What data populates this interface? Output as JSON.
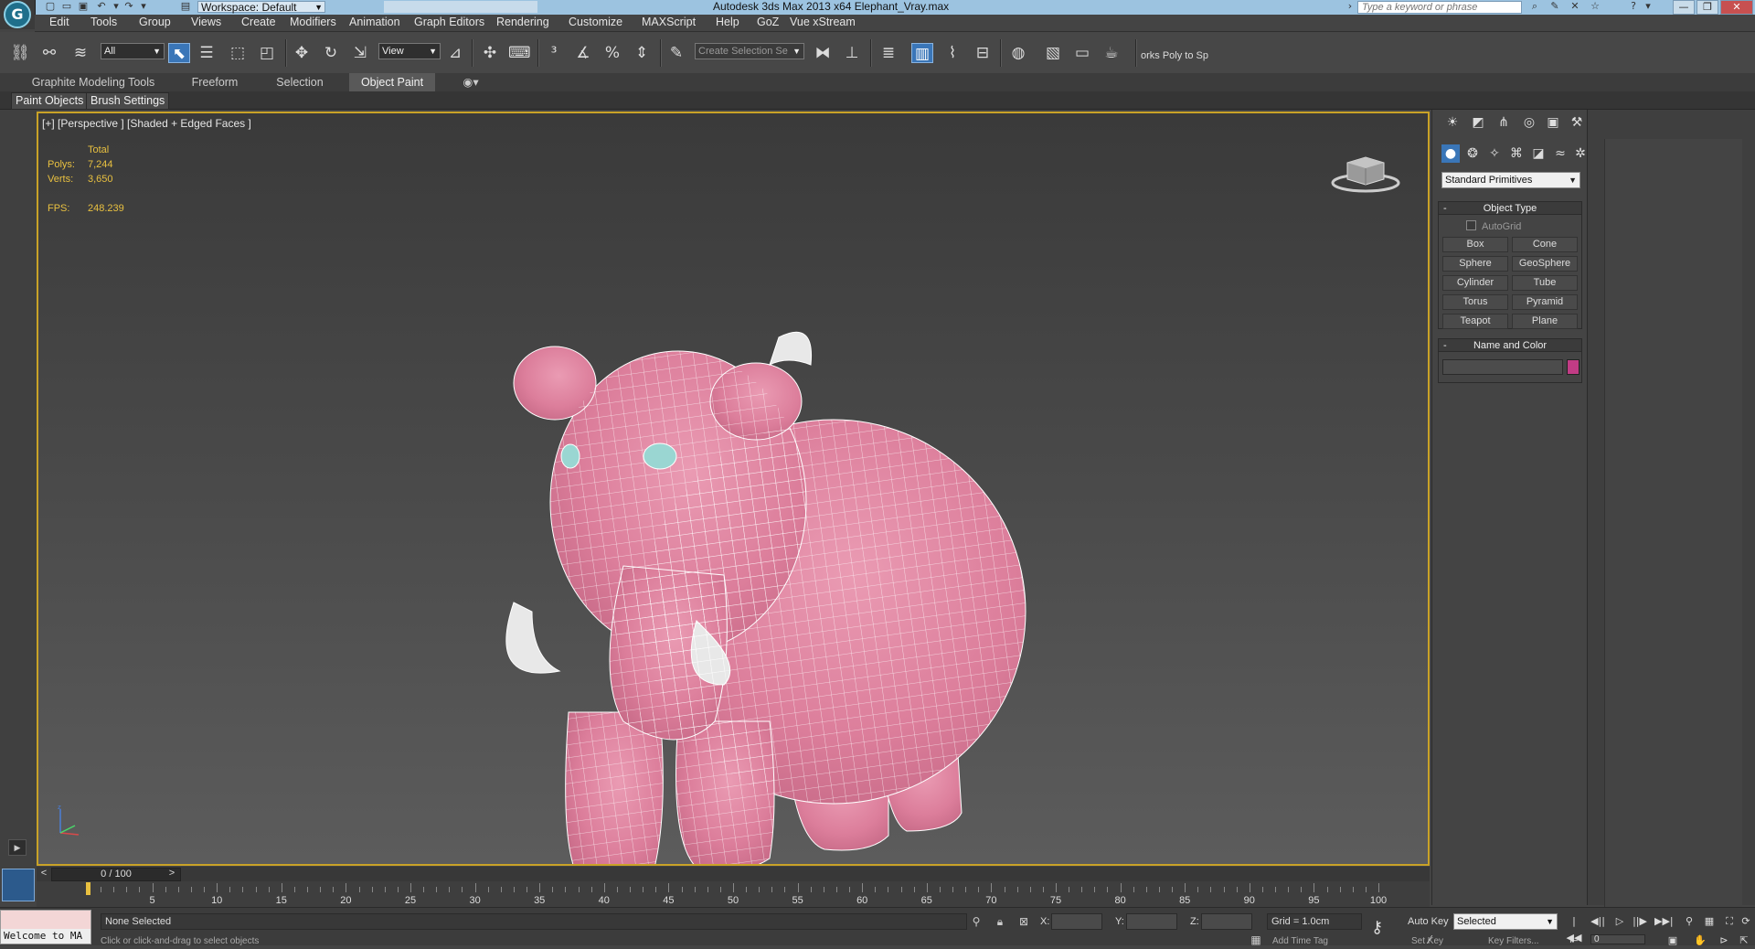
{
  "title_bar": {
    "workspace": "Workspace: Default",
    "app_title": "Autodesk 3ds Max  2013 x64      Elephant_Vray.max",
    "search_placeholder": "Type a keyword or phrase"
  },
  "menu": {
    "items": [
      "Edit",
      "Tools",
      "Group",
      "Views",
      "Create",
      "Modifiers",
      "Animation",
      "Graph Editors",
      "Rendering",
      "Customize",
      "MAXScript",
      "Help",
      "GoZ",
      "Vue xStream"
    ]
  },
  "toolbar": {
    "filter_value": "All",
    "coord_system_value": "View",
    "selection_set_placeholder": "Create Selection Se",
    "partial_label": "orks Poly to Sp"
  },
  "ribbon": {
    "tabs": [
      "Graphite Modeling Tools",
      "Freeform",
      "Selection",
      "Object Paint"
    ],
    "active_tab": "Object Paint",
    "sub_tabs": [
      "Paint Objects",
      "Brush Settings"
    ]
  },
  "viewport": {
    "label": "[+] [Perspective ] [Shaded + Edged Faces ]",
    "stats": {
      "header": "Total",
      "polys_label": "Polys:",
      "polys_value": "7,244",
      "verts_label": "Verts:",
      "verts_value": "3,650",
      "fps_label": "FPS:",
      "fps_value": "248.239"
    },
    "model_color": "#e58aa6",
    "highlight_color": "#c9a227"
  },
  "command_panel": {
    "dropdown_value": "Standard Primitives",
    "object_type_title": "Object Type",
    "autogrid_label": "AutoGrid",
    "primitives": [
      "Box",
      "Cone",
      "Sphere",
      "GeoSphere",
      "Cylinder",
      "Tube",
      "Torus",
      "Pyramid",
      "Teapot",
      "Plane"
    ],
    "name_color_title": "Name and Color",
    "object_color": "#c13c85"
  },
  "timeline": {
    "slider_value": "0 / 100",
    "ticks": [
      "5",
      "10",
      "15",
      "20",
      "25",
      "30",
      "35",
      "40",
      "45",
      "50",
      "55",
      "60",
      "65",
      "70",
      "75",
      "80",
      "85",
      "90",
      "95",
      "100"
    ]
  },
  "status": {
    "maxscript_text": "Welcome to MA",
    "selection_status": "None Selected",
    "prompt": "Click or click-and-drag to select objects",
    "x_label": "X:",
    "y_label": "Y:",
    "z_label": "Z:",
    "grid": "Grid = 1.0cm",
    "add_time_tag": "Add Time Tag",
    "auto_key": "Auto Key",
    "set_key": "Set Key",
    "key_mode_value": "Selected",
    "key_filters": "Key Filters...",
    "frame_value": "0"
  }
}
